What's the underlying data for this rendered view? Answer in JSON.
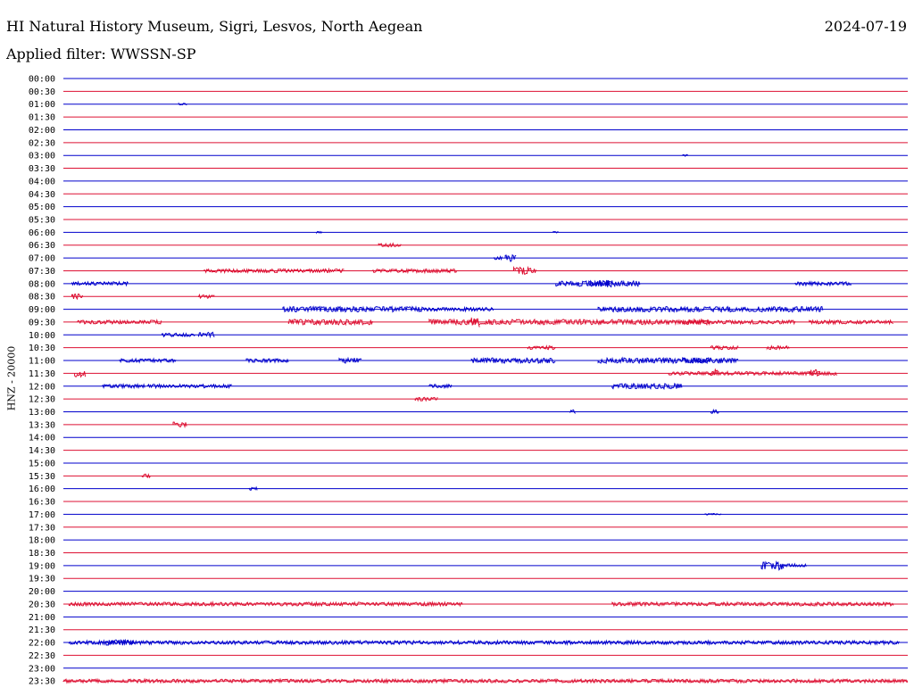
{
  "header": {
    "title": "HI Natural History Museum, Sigri, Lesvos, North Aegean",
    "date": "2024-07-19",
    "filter": "Applied filter: WWSSN-SP"
  },
  "colors": {
    "blue_trace": "#0000cc",
    "red_trace": "#dd1133"
  },
  "chart_data": {
    "type": "line",
    "ylabel": "HNZ - 20000",
    "row_labels": [
      "00:00",
      "00:30",
      "01:00",
      "01:30",
      "02:00",
      "02:30",
      "03:00",
      "03:30",
      "04:00",
      "04:30",
      "05:00",
      "05:30",
      "06:00",
      "06:30",
      "07:00",
      "07:30",
      "08:00",
      "08:30",
      "09:00",
      "09:30",
      "10:00",
      "10:30",
      "11:00",
      "11:30",
      "12:00",
      "12:30",
      "13:00",
      "13:30",
      "14:00",
      "14:30",
      "15:00",
      "15:30",
      "16:00",
      "16:30",
      "17:00",
      "17:30",
      "18:00",
      "18:30",
      "19:00",
      "19:30",
      "20:00",
      "20:30",
      "21:00",
      "21:30",
      "22:00",
      "22:30",
      "23:00",
      "23:30"
    ],
    "row_colors": [
      "blue",
      "red"
    ],
    "x_range_minutes": [
      0,
      30
    ],
    "activity": [
      {
        "row": "01:00",
        "bursts": [
          [
            4.1,
            0.3,
            1
          ]
        ]
      },
      {
        "row": "03:00",
        "bursts": [
          [
            22.0,
            0.2,
            1
          ]
        ]
      },
      {
        "row": "06:00",
        "bursts": [
          [
            9.0,
            0.2,
            1
          ],
          [
            17.4,
            0.2,
            1
          ]
        ]
      },
      {
        "row": "06:30",
        "bursts": [
          [
            11.2,
            0.8,
            2
          ]
        ]
      },
      {
        "row": "07:00",
        "bursts": [
          [
            15.3,
            0.3,
            2
          ],
          [
            15.7,
            0.4,
            4
          ]
        ]
      },
      {
        "row": "07:30",
        "bursts": [
          [
            5.0,
            2.5,
            2
          ],
          [
            7.5,
            2.5,
            2
          ],
          [
            11.0,
            3.0,
            2
          ],
          [
            16.0,
            0.8,
            4
          ]
        ]
      },
      {
        "row": "08:00",
        "bursts": [
          [
            0.3,
            2.0,
            2
          ],
          [
            17.5,
            3.0,
            3
          ],
          [
            18.7,
            0.8,
            4
          ],
          [
            26.0,
            2.0,
            2
          ]
        ]
      },
      {
        "row": "08:30",
        "bursts": [
          [
            0.3,
            0.4,
            3
          ],
          [
            4.8,
            0.6,
            2
          ]
        ]
      },
      {
        "row": "09:00",
        "bursts": [
          [
            7.8,
            5.0,
            3
          ],
          [
            12.8,
            2.5,
            2
          ],
          [
            19.0,
            5.0,
            3
          ],
          [
            24.0,
            3.0,
            3
          ]
        ]
      },
      {
        "row": "09:30",
        "bursts": [
          [
            0.5,
            3.0,
            2
          ],
          [
            8.0,
            3.0,
            3
          ],
          [
            13.0,
            10.0,
            3
          ],
          [
            14.5,
            0.3,
            6
          ],
          [
            22.0,
            4.0,
            2
          ],
          [
            26.5,
            3.0,
            2
          ]
        ]
      },
      {
        "row": "10:00",
        "bursts": [
          [
            3.5,
            1.2,
            2
          ],
          [
            4.8,
            0.6,
            3
          ]
        ]
      },
      {
        "row": "10:30",
        "bursts": [
          [
            16.5,
            1.0,
            2
          ],
          [
            23.0,
            1.0,
            2
          ],
          [
            25.0,
            0.8,
            2
          ]
        ]
      },
      {
        "row": "11:00",
        "bursts": [
          [
            2.0,
            2.0,
            2
          ],
          [
            6.5,
            1.5,
            2
          ],
          [
            9.8,
            0.8,
            3
          ],
          [
            14.5,
            3.0,
            3
          ],
          [
            19.0,
            5.0,
            3
          ],
          [
            22.0,
            1.0,
            3
          ]
        ]
      },
      {
        "row": "11:30",
        "bursts": [
          [
            0.4,
            0.4,
            4
          ],
          [
            21.5,
            6.0,
            2
          ],
          [
            23.0,
            0.3,
            5
          ],
          [
            26.5,
            0.4,
            4
          ]
        ]
      },
      {
        "row": "12:00",
        "bursts": [
          [
            1.4,
            1.5,
            2
          ],
          [
            3.0,
            3.0,
            2
          ],
          [
            13.0,
            0.8,
            2
          ],
          [
            19.5,
            2.5,
            3
          ]
        ]
      },
      {
        "row": "12:30",
        "bursts": [
          [
            12.5,
            0.8,
            2
          ]
        ]
      },
      {
        "row": "13:00",
        "bursts": [
          [
            18.0,
            0.2,
            2
          ],
          [
            23.0,
            0.3,
            2
          ]
        ]
      },
      {
        "row": "13:30",
        "bursts": [
          [
            3.9,
            0.5,
            3
          ]
        ]
      },
      {
        "row": "15:30",
        "bursts": [
          [
            2.8,
            0.3,
            2
          ]
        ]
      },
      {
        "row": "16:00",
        "bursts": [
          [
            6.6,
            0.3,
            2
          ]
        ]
      },
      {
        "row": "17:00",
        "bursts": [
          [
            22.8,
            0.6,
            1
          ]
        ]
      },
      {
        "row": "19:00",
        "bursts": [
          [
            24.8,
            0.6,
            4
          ],
          [
            25.3,
            0.3,
            5
          ],
          [
            25.6,
            0.8,
            2
          ]
        ]
      },
      {
        "row": "20:30",
        "bursts": [
          [
            0.2,
            14.0,
            2
          ],
          [
            19.5,
            10.0,
            2
          ]
        ]
      },
      {
        "row": "22:00",
        "bursts": [
          [
            0.2,
            29.5,
            2
          ],
          [
            1.5,
            1.0,
            3
          ]
        ]
      },
      {
        "row": "23:30",
        "bursts": [
          [
            0.0,
            30.0,
            2
          ]
        ]
      }
    ]
  }
}
